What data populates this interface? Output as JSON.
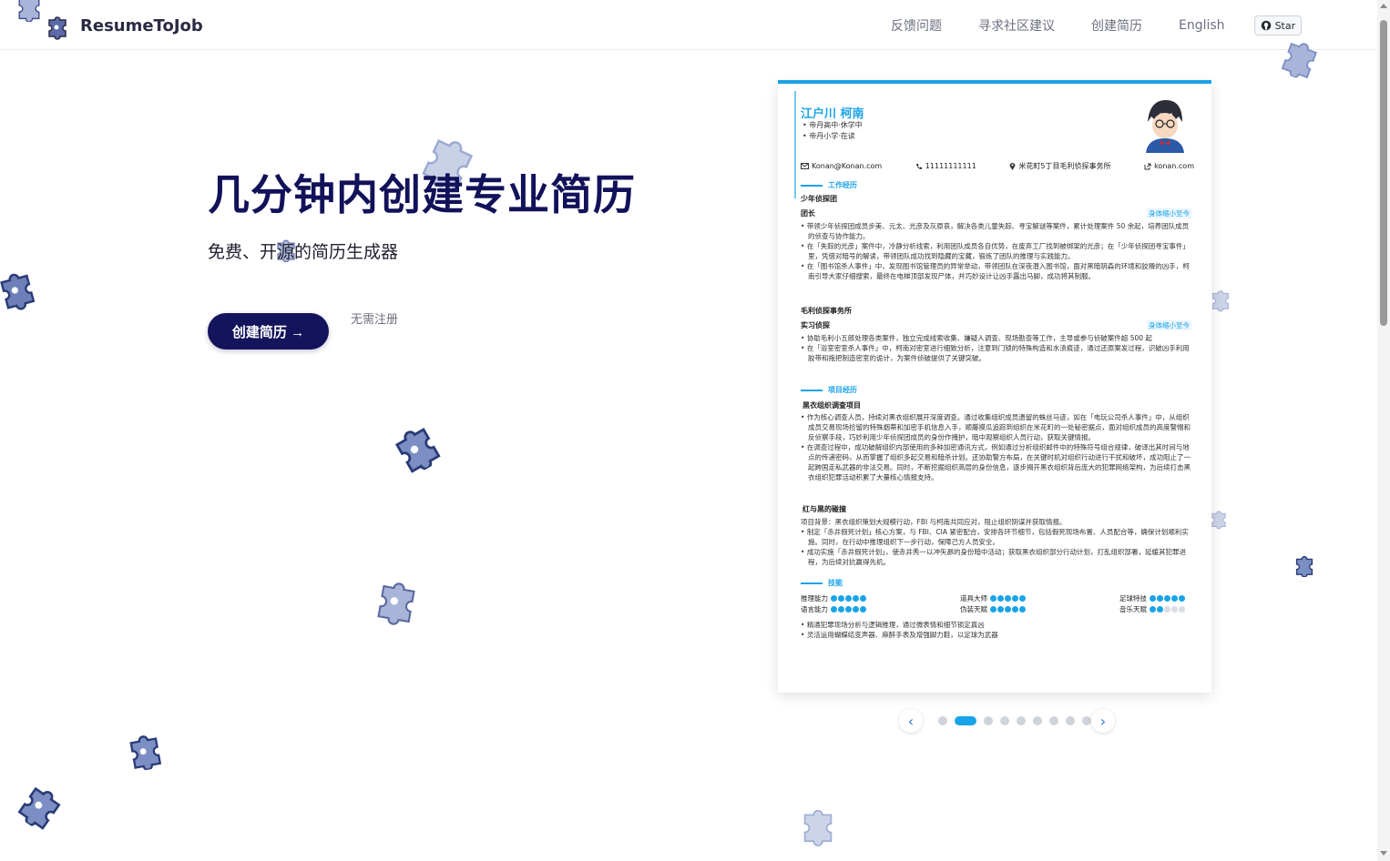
{
  "header": {
    "brand": "ResumeToJob",
    "nav": [
      "反馈问题",
      "寻求社区建议",
      "创建简历",
      "English"
    ],
    "star_label": "Star"
  },
  "hero": {
    "title": "几分钟内创建专业简历",
    "subtitle": "免费、开源的简历生成器",
    "cta_label": "创建简历 →",
    "note": "无需注册"
  },
  "resume": {
    "name": "江户川 柯南",
    "subtitles": [
      "帝丹高中·休学中",
      "帝丹小学·在读"
    ],
    "contacts": {
      "email": "Konan@Konan.com",
      "phone": "11111111111",
      "address": "米花町5丁目毛利侦探事务所",
      "website": "konan.com"
    },
    "sections": {
      "work": "工作经历",
      "project": "项目经历",
      "skills": "技能"
    },
    "work": [
      {
        "company": "少年侦探团",
        "role": "团长",
        "date": "身体缩小至今",
        "bullets": [
          "带领少年侦探团成员步美、元太、光彦及灰原哀，解决各类儿童失踪、寻宝解谜等案件，累计处理案件 50 余起，培养团队成员的侦查与协作能力。",
          "在「失踪的光彦」案件中，冷静分析线索，利用团队成员各自优势，在废弃工厂找到被绑架的光彦；在「少年侦探团寻宝事件」里，凭借对暗号的解读，带领团队成功找到隐藏的宝藏，锻炼了团队的推理与实践能力。",
          "在「图书馆杀人事件」中，发现图书馆管理员的异常举动，带领团队在深夜潜入图书馆，面对黑暗阴森的环境和狡猾的凶手，柯南引导大家仔细搜索，最终在电梯顶部发现尸体，并巧妙设计让凶手露出马脚，成功将其制服。"
        ]
      },
      {
        "company": "毛利侦探事务所",
        "role": "实习侦探",
        "date": "身体缩小至今",
        "bullets": [
          "协助毛利小五郎处理各类案件，独立完成线索收集、嫌疑人调查、现场勘查等工作，主导或参与侦破案件超 500 起",
          "在「浴室密室杀人事件」中，柯南对密室进行细致分析，注意到门锁的特殊构造和水渍痕迹，通过还原案发过程，识破凶手利用胶带和拖把制造密室的诡计，为案件侦破提供了关键突破。"
        ]
      }
    ],
    "projects": [
      {
        "name": "黑衣组织调查项目",
        "bullets": [
          "作为核心调查人员，持续对黑衣组织展开深度调查。通过收集组织成员遗留的蛛丝马迹，如在「电玩公司杀人事件」中，从组织成员交易现场捡留的特殊烟蒂和加密手机信息入手，顺藤摸瓜追踪到组织在米花町的一处秘密据点，面对组织成员的高度警惕和反侦察手段，巧妙利用少年侦探团成员的身份作掩护，暗中观察组织人员行动，获取关键情报。",
          "在调查过程中，成功破解组织内部使用的多种加密通讯方式，例如通过分析组织邮件中的特殊符号组合规律，破译出其时间与地点的传递密码，从而掌握了组织多起交易和暗杀计划。还协助警方布局，在关键时机对组织行动进行干扰和破坏，成功阻止了一起跨国走私武器的非法交易。同时，不断挖掘组织高层的身份信息，逐步揭开黑衣组织背后庞大的犯罪网络架构，为后续打击黑衣组织犯罪活动积累了大量核心情报支持。"
        ]
      },
      {
        "name": "红与黑的碰撞",
        "intro": "项目背景：黑衣组织策划大规模行动，FBI 与柯南共同应对，阻止组织阴谋并获取情报。",
        "bullets": [
          "制定「赤井假死计划」核心方案，与 FBI、CIA 紧密配合，安排各环节细节，包括假死现场布置、人员配合等，确保计划顺利实施。同时，在行动中推理组织下一步行动，保障己方人员安全。",
          "成功实施「赤井假死计划」，使赤井秀一以冲矢昴的身份暗中活动；获取黑衣组织部分行动计划，打乱组织部署，延缓其犯罪进程，为后续对抗赢得先机。"
        ]
      }
    ],
    "skills": [
      {
        "name": "推理能力",
        "level": 5
      },
      {
        "name": "道具大师",
        "level": 5
      },
      {
        "name": "足球特技",
        "level": 5
      },
      {
        "name": "语言能力",
        "level": 5
      },
      {
        "name": "伪装天赋",
        "level": 5
      },
      {
        "name": "音乐天赋",
        "level": 2
      }
    ],
    "skill_notes": [
      "精通犯罪现场分析与逻辑推理，通过微表情和细节锁定真凶",
      "灵活运用蝴蝶结变声器、麻醉手表及增强脚力鞋，以足球为武器"
    ]
  },
  "carousel": {
    "slides": 9,
    "active": 1,
    "prev_icon": "‹",
    "next_icon": "›"
  },
  "colors": {
    "accent": "#1aa3e8",
    "title": "#12125a",
    "cta": "#14145c",
    "puzzle": "#7c8fc4"
  }
}
